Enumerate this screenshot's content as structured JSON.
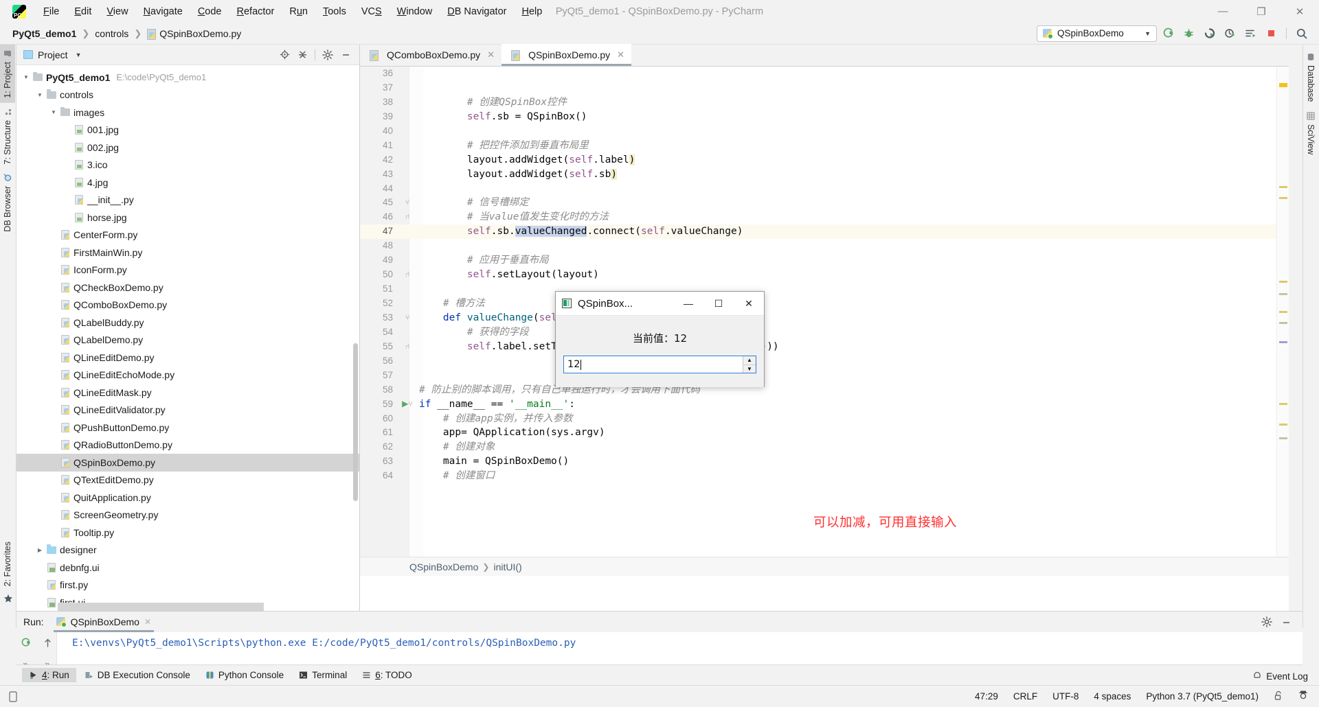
{
  "window": {
    "title": "PyQt5_demo1 - QSpinBoxDemo.py - PyCharm",
    "minimize": "—",
    "restore": "❐",
    "close": "✕"
  },
  "menu": [
    {
      "label": "File"
    },
    {
      "label": "Edit"
    },
    {
      "label": "View"
    },
    {
      "label": "Navigate"
    },
    {
      "label": "Code"
    },
    {
      "label": "Refactor"
    },
    {
      "label": "Run"
    },
    {
      "label": "Tools"
    },
    {
      "label": "VCS"
    },
    {
      "label": "Window"
    },
    {
      "label": "DB Navigator"
    },
    {
      "label": "Help"
    }
  ],
  "navbar": {
    "breadcrumbs": [
      "PyQt5_demo1",
      "controls",
      "QSpinBoxDemo.py"
    ],
    "run_config": "QSpinBoxDemo",
    "toolbar_icons": [
      "rerun-icon",
      "debug-icon",
      "coverage-icon",
      "profile-icon",
      "run-with-params-icon",
      "stop-icon",
      "search-icon"
    ]
  },
  "left_strip": {
    "items": [
      {
        "label": "1: Project",
        "icon": "project-folder-icon",
        "active": true
      },
      {
        "label": "7: Structure",
        "icon": "structure-icon",
        "active": false
      },
      {
        "label": "DB Browser",
        "icon": "db-browser-icon",
        "active": false
      }
    ],
    "bottom": [
      {
        "label": "2: Favorites",
        "icon": "star-icon"
      }
    ]
  },
  "right_strip": {
    "items": [
      {
        "label": "Database",
        "icon": "database-icon"
      },
      {
        "label": "SciView",
        "icon": "sciview-icon"
      }
    ]
  },
  "project_panel": {
    "title": "Project",
    "actions": [
      "locate-icon",
      "collapse-all-icon",
      "settings-gear-icon",
      "hide-icon"
    ],
    "tree": [
      {
        "indent": 0,
        "twisty": "▼",
        "icon": "folder",
        "label": "PyQt5_demo1",
        "bold": true,
        "path": "E:\\code\\PyQt5_demo1"
      },
      {
        "indent": 1,
        "twisty": "▼",
        "icon": "folder",
        "label": "controls"
      },
      {
        "indent": 2,
        "twisty": "▼",
        "icon": "folder",
        "label": "images"
      },
      {
        "indent": 3,
        "twisty": "",
        "icon": "image-file",
        "label": "001.jpg"
      },
      {
        "indent": 3,
        "twisty": "",
        "icon": "image-file",
        "label": "002.jpg"
      },
      {
        "indent": 3,
        "twisty": "",
        "icon": "image-file",
        "label": "3.ico"
      },
      {
        "indent": 3,
        "twisty": "",
        "icon": "image-file",
        "label": "4.jpg"
      },
      {
        "indent": 3,
        "twisty": "",
        "icon": "py-file",
        "label": "__init__.py"
      },
      {
        "indent": 3,
        "twisty": "",
        "icon": "image-file",
        "label": "horse.jpg"
      },
      {
        "indent": 2,
        "twisty": "",
        "icon": "py-file",
        "label": "CenterForm.py"
      },
      {
        "indent": 2,
        "twisty": "",
        "icon": "py-file",
        "label": "FirstMainWin.py"
      },
      {
        "indent": 2,
        "twisty": "",
        "icon": "py-file",
        "label": "IconForm.py"
      },
      {
        "indent": 2,
        "twisty": "",
        "icon": "py-file",
        "label": "QCheckBoxDemo.py"
      },
      {
        "indent": 2,
        "twisty": "",
        "icon": "py-file",
        "label": "QComboBoxDemo.py"
      },
      {
        "indent": 2,
        "twisty": "",
        "icon": "py-file",
        "label": "QLabelBuddy.py"
      },
      {
        "indent": 2,
        "twisty": "",
        "icon": "py-file",
        "label": "QLabelDemo.py"
      },
      {
        "indent": 2,
        "twisty": "",
        "icon": "py-file",
        "label": "QLineEditDemo.py"
      },
      {
        "indent": 2,
        "twisty": "",
        "icon": "py-file",
        "label": "QLineEditEchoMode.py"
      },
      {
        "indent": 2,
        "twisty": "",
        "icon": "py-file",
        "label": "QLineEditMask.py"
      },
      {
        "indent": 2,
        "twisty": "",
        "icon": "py-file",
        "label": "QLineEditValidator.py"
      },
      {
        "indent": 2,
        "twisty": "",
        "icon": "py-file",
        "label": "QPushButtonDemo.py"
      },
      {
        "indent": 2,
        "twisty": "",
        "icon": "py-file",
        "label": "QRadioButtonDemo.py"
      },
      {
        "indent": 2,
        "twisty": "",
        "icon": "py-file",
        "label": "QSpinBoxDemo.py",
        "selected": true
      },
      {
        "indent": 2,
        "twisty": "",
        "icon": "py-file",
        "label": "QTextEditDemo.py"
      },
      {
        "indent": 2,
        "twisty": "",
        "icon": "py-file",
        "label": "QuitApplication.py"
      },
      {
        "indent": 2,
        "twisty": "",
        "icon": "py-file",
        "label": "ScreenGeometry.py"
      },
      {
        "indent": 2,
        "twisty": "",
        "icon": "py-file",
        "label": "Tooltip.py"
      },
      {
        "indent": 1,
        "twisty": "▶",
        "icon": "folder-blue",
        "label": "designer"
      },
      {
        "indent": 1,
        "twisty": "",
        "icon": "ui-file",
        "label": "debnfg.ui"
      },
      {
        "indent": 1,
        "twisty": "",
        "icon": "py-file",
        "label": "first.py"
      },
      {
        "indent": 1,
        "twisty": "",
        "icon": "ui-file",
        "label": "first.ui"
      }
    ]
  },
  "editor": {
    "tabs": [
      {
        "label": "QComboBoxDemo.py",
        "active": false
      },
      {
        "label": "QSpinBoxDemo.py",
        "active": true
      }
    ],
    "first_line": 36,
    "lines": [
      {
        "n": 36,
        "fold": "",
        "html": ""
      },
      {
        "n": 37,
        "fold": "",
        "html": ""
      },
      {
        "n": 38,
        "fold": "",
        "html": "        <span class='cmt'># 创建QSpinBox控件</span>"
      },
      {
        "n": 39,
        "fold": "",
        "html": "        <span class='self'>self</span>.sb = QSpinBox()"
      },
      {
        "n": 40,
        "fold": "",
        "html": ""
      },
      {
        "n": 41,
        "fold": "",
        "html": "        <span class='cmt'># 把控件添加到垂直布局里</span>"
      },
      {
        "n": 42,
        "fold": "",
        "html": "        layout.addWidget(<span class='self'>self</span>.label<span class='hl-brace'>)</span>"
      },
      {
        "n": 43,
        "fold": "",
        "html": "        layout.addWidget(<span class='self'>self</span>.sb<span class='hl-brace'>)</span>"
      },
      {
        "n": 44,
        "fold": "",
        "html": ""
      },
      {
        "n": 45,
        "fold": "⑂",
        "html": "        <span class='cmt'># 信号槽绑定</span>"
      },
      {
        "n": 46,
        "fold": "⑁",
        "html": "        <span class='cmt'># 当value值发生变化时的方法</span>"
      },
      {
        "n": 47,
        "fold": "",
        "cur": true,
        "html": "        <span class='self'>self</span>.sb.<span class='hl-sel'>valueChanged</span>.connect(<span class='self'>self</span>.valueChange)"
      },
      {
        "n": 48,
        "fold": "",
        "html": ""
      },
      {
        "n": 49,
        "fold": "",
        "html": "        <span class='cmt'># 应用于垂直布局</span>"
      },
      {
        "n": 50,
        "fold": "⑁",
        "html": "        <span class='self'>self</span>.setLayout(layout)"
      },
      {
        "n": 51,
        "fold": "",
        "html": ""
      },
      {
        "n": 52,
        "fold": "",
        "html": "    <span class='cmt'># 槽方法</span>"
      },
      {
        "n": 53,
        "fold": "⑂",
        "html": "    <span class='kw'>def</span> <span class='fn'>valueChange</span>(<span class='self'>self</span>):"
      },
      {
        "n": 54,
        "fold": "",
        "html": "        <span class='cmt'># 获得的字段</span>"
      },
      {
        "n": 55,
        "fold": "⑁",
        "html": "        <span class='self'>self</span>.label.setText(<span class='str'>'当前值: '</span> + str(<span class='self'>self</span>.sb.value()))"
      },
      {
        "n": 56,
        "fold": "",
        "html": ""
      },
      {
        "n": 57,
        "fold": "",
        "html": ""
      },
      {
        "n": 58,
        "fold": "",
        "html": "<span class='cmt'># 防止别的脚本调用，只有自己单独运行时，才会调用下面代码</span>"
      },
      {
        "n": 59,
        "fold": "⑂",
        "runmark": true,
        "html": "<span class='kw'>if</span> __name__ == <span class='str'>'__main__'</span>:"
      },
      {
        "n": 60,
        "fold": "",
        "html": "    <span class='cmt'># 创建app实例，并传入参数</span>"
      },
      {
        "n": 61,
        "fold": "",
        "html": "    app= QApplication(sys.argv)"
      },
      {
        "n": 62,
        "fold": "",
        "html": "    <span class='cmt'># 创建对象</span>"
      },
      {
        "n": 63,
        "fold": "",
        "html": "    main = QSpinBoxDemo()"
      },
      {
        "n": 64,
        "fold": "",
        "html": "    <span class='cmt'># 创建窗口</span>"
      }
    ],
    "annotation": "可以加减，可用直接输入",
    "annotation_color": "#ff2f2f",
    "breadcrumb": [
      "QSpinBoxDemo",
      "initUI()"
    ]
  },
  "dialog": {
    "title": "QSpinBox...",
    "label": "当前值：12",
    "spin_value": "12",
    "minimize": "—",
    "maximize": "☐",
    "close": "✕"
  },
  "run_panel": {
    "label": "Run:",
    "tab": "QSpinBoxDemo",
    "console_output": "E:\\venvs\\PyQt5_demo1\\Scripts\\python.exe E:/code/PyQt5_demo1/controls/QSpinBoxDemo.py",
    "gutter_icons": [
      "rerun-icon",
      "up-arrow-icon",
      "expand-icon",
      "expand2-icon"
    ],
    "bottom_tabs": [
      {
        "label": "4: Run",
        "icon": "run-icon",
        "active": true
      },
      {
        "label": "DB Execution Console",
        "icon": "db-console-icon",
        "active": false
      },
      {
        "label": "Python Console",
        "icon": "python-console-icon",
        "active": false
      },
      {
        "label": "Terminal",
        "icon": "terminal-icon",
        "active": false
      },
      {
        "label": "6: TODO",
        "icon": "todo-icon",
        "active": false
      }
    ],
    "settings_icon": "gear-icon",
    "hide_icon": "minimize-icon"
  },
  "statusbar": {
    "event_log": "Event Log",
    "caret_position": "47:29",
    "line_separator": "CRLF",
    "encoding": "UTF-8",
    "indent": "4 spaces",
    "interpreter": "Python 3.7 (PyQt5_demo1)",
    "lock_icon": "unlock-icon",
    "inspection_icon": "inspector-icon"
  }
}
